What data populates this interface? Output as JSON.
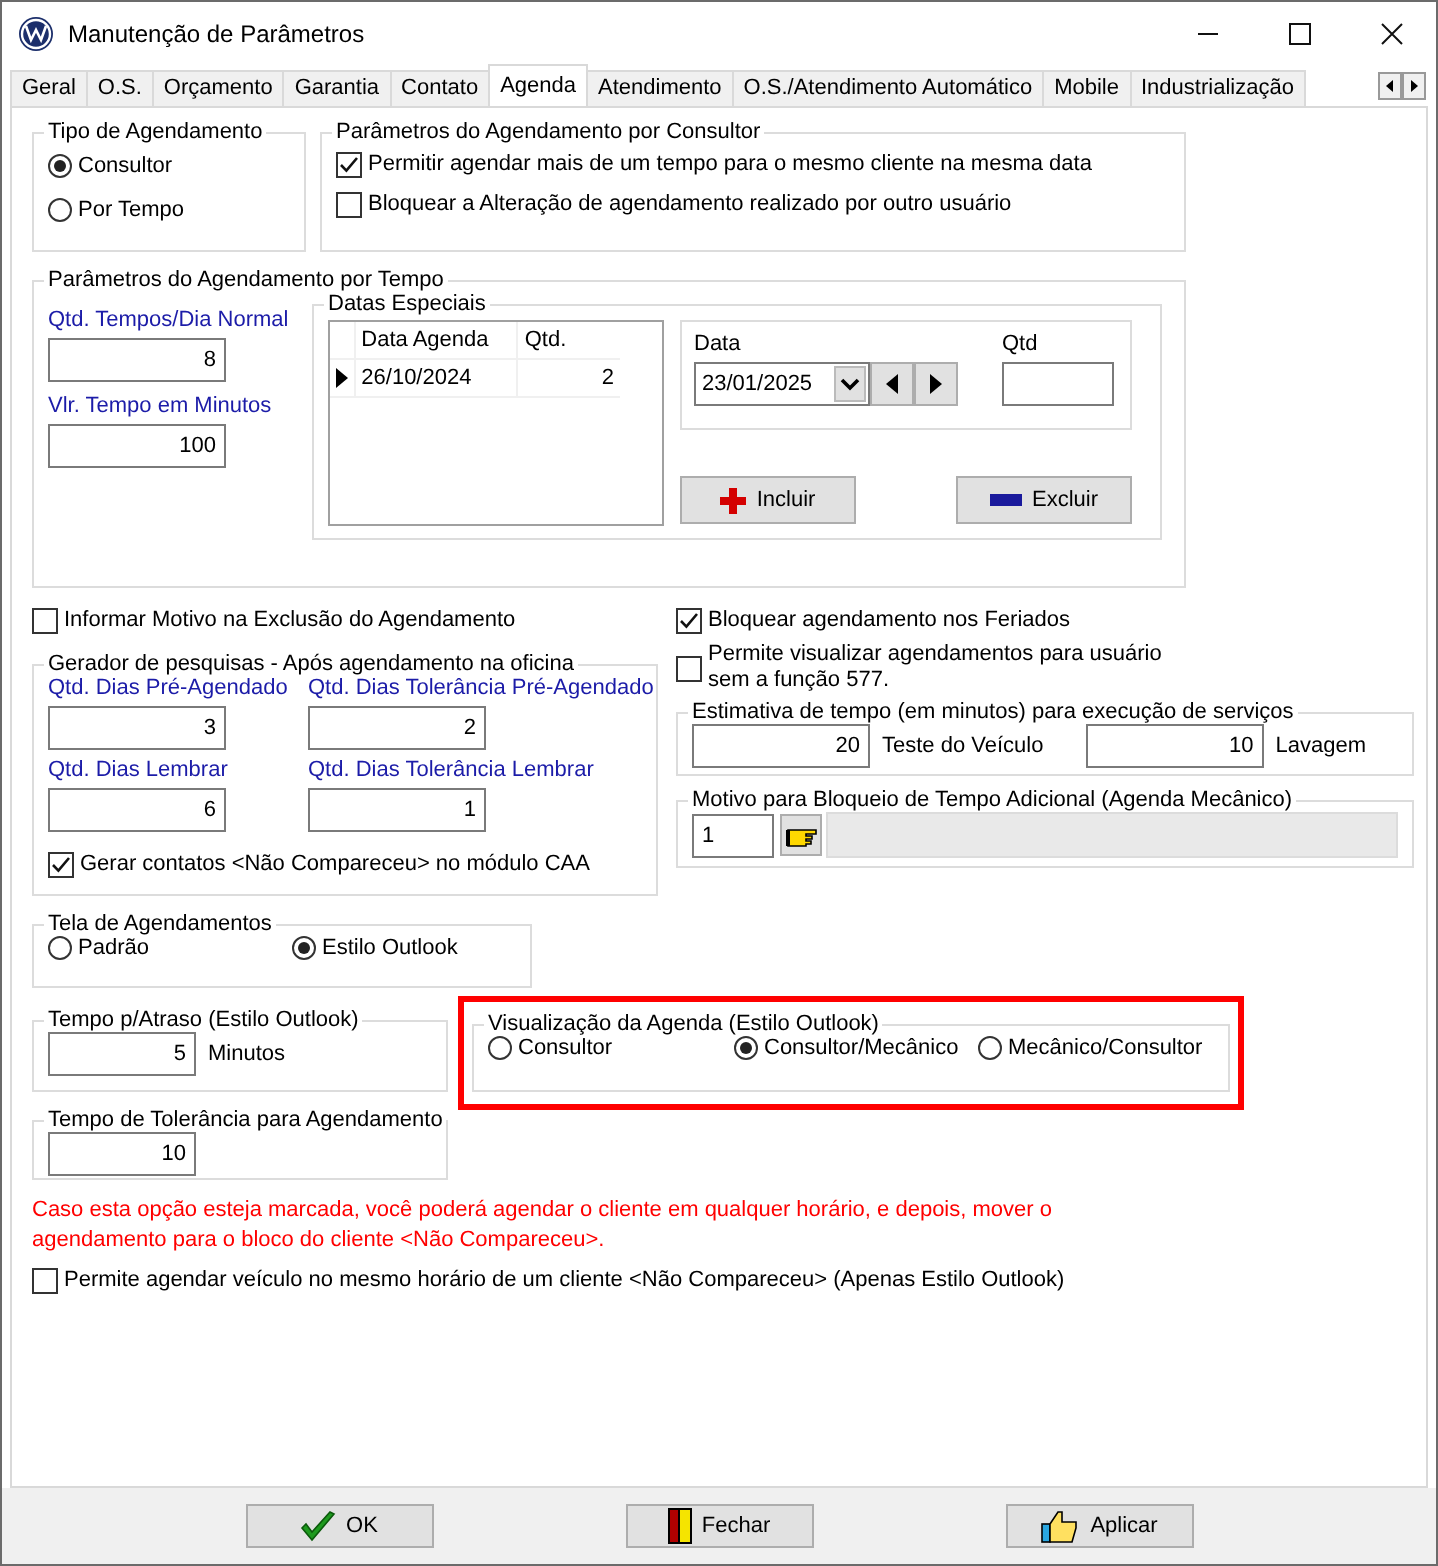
{
  "window": {
    "title": "Manutenção de Parâmetros"
  },
  "tabs": [
    {
      "label": "Geral",
      "selected": false
    },
    {
      "label": "O.S.",
      "selected": false
    },
    {
      "label": "Orçamento",
      "selected": false
    },
    {
      "label": "Garantia",
      "selected": false
    },
    {
      "label": "Contato",
      "selected": false
    },
    {
      "label": "Agenda",
      "selected": true
    },
    {
      "label": "Atendimento",
      "selected": false
    },
    {
      "label": "O.S./Atendimento Automático",
      "selected": false
    },
    {
      "label": "Mobile",
      "selected": false
    },
    {
      "label": "Industrialização",
      "selected": false
    }
  ],
  "tipo_agendamento": {
    "title": "Tipo de Agendamento",
    "options": [
      {
        "label": "Consultor",
        "selected": true
      },
      {
        "label": "Por Tempo",
        "selected": false
      }
    ]
  },
  "parametros_consultor": {
    "title": "Parâmetros do Agendamento por Consultor",
    "options": [
      {
        "label": "Permitir agendar mais de um tempo para o mesmo cliente na mesma data",
        "checked": true
      },
      {
        "label": "Bloquear a Alteração de agendamento realizado por outro usuário",
        "checked": false
      }
    ]
  },
  "parametros_tempo": {
    "title": "Parâmetros do Agendamento por Tempo",
    "fields": [
      {
        "label": "Qtd. Tempos/Dia Normal",
        "value": "8"
      },
      {
        "label": "Vlr. Tempo em Minutos",
        "value": "100"
      }
    ],
    "datas_especiais": {
      "title": "Datas Especiais",
      "columns": [
        "Data Agenda",
        "Qtd."
      ],
      "rows": [
        {
          "date": "26/10/2024",
          "qtd": "2"
        }
      ]
    },
    "data": {
      "label": "Data",
      "value": "23/01/2025"
    },
    "qtd": {
      "label": "Qtd"
    },
    "buttons": [
      {
        "label": "Incluir",
        "kind": "add"
      },
      {
        "label": "Excluir",
        "kind": "remove"
      }
    ]
  },
  "informar_motivo": {
    "label": "Informar Motivo na Exclusão do Agendamento",
    "checked": false
  },
  "gerador": {
    "title": "Gerador de pesquisas - Após agendamento na oficina",
    "fields": [
      {
        "label": "Qtd. Dias Pré-Agendado",
        "value": "3"
      },
      {
        "label": "Qtd. Dias Tolerância Pré-Agendado",
        "value": "2"
      },
      {
        "label": "Qtd. Dias Lembrar",
        "value": "6"
      },
      {
        "label": "Qtd. Dias Tolerância Lembrar",
        "value": "1"
      }
    ],
    "gerar": {
      "label": "Gerar contatos <Não Compareceu> no módulo CAA",
      "checked": true
    }
  },
  "bloquear_feriados": {
    "label": "Bloquear agendamento nos Feriados",
    "checked": true
  },
  "permite_visualizar": {
    "label": "Permite visualizar agendamentos para usuário sem a função 577.",
    "checked": false
  },
  "estimativa": {
    "title": "Estimativa de tempo (em minutos) para execução de serviços",
    "fields": [
      {
        "value": "20",
        "label": "Teste do Veículo"
      },
      {
        "value": "10",
        "label": "Lavagem"
      }
    ]
  },
  "motivo_bloqueio": {
    "title": "Motivo para Bloqueio de Tempo Adicional (Agenda Mecânico)",
    "code": "1"
  },
  "tela": {
    "title": "Tela de Agendamentos",
    "options": [
      {
        "label": "Padrão",
        "selected": false
      },
      {
        "label": "Estilo Outlook",
        "selected": true
      }
    ]
  },
  "tempo_atraso": {
    "title": "Tempo p/Atraso (Estilo Outlook)",
    "value": "5",
    "unit": "Minutos"
  },
  "tempo_tolerancia": {
    "title": "Tempo de Tolerância para Agendamento",
    "value": "10"
  },
  "visualizacao": {
    "title": "Visualização da Agenda (Estilo Outlook)",
    "highlighted": true,
    "options": [
      {
        "label": "Consultor",
        "selected": false
      },
      {
        "label": "Consultor/Mecânico",
        "selected": true
      },
      {
        "label": "Mecânico/Consultor",
        "selected": false
      }
    ]
  },
  "warning": "Caso esta opção esteja marcada, você poderá agendar o cliente em qualquer horário, e depois, mover o agendamento para o bloco do cliente <Não Compareceu>.",
  "permite_agendar": {
    "label": "Permite agendar veículo no mesmo horário de um cliente <Não Compareceu> (Apenas Estilo Outlook)",
    "checked": false
  },
  "buttons": [
    {
      "label": "OK",
      "kind": "ok"
    },
    {
      "label": "Fechar",
      "kind": "close"
    },
    {
      "label": "Aplicar",
      "kind": "apply"
    }
  ]
}
